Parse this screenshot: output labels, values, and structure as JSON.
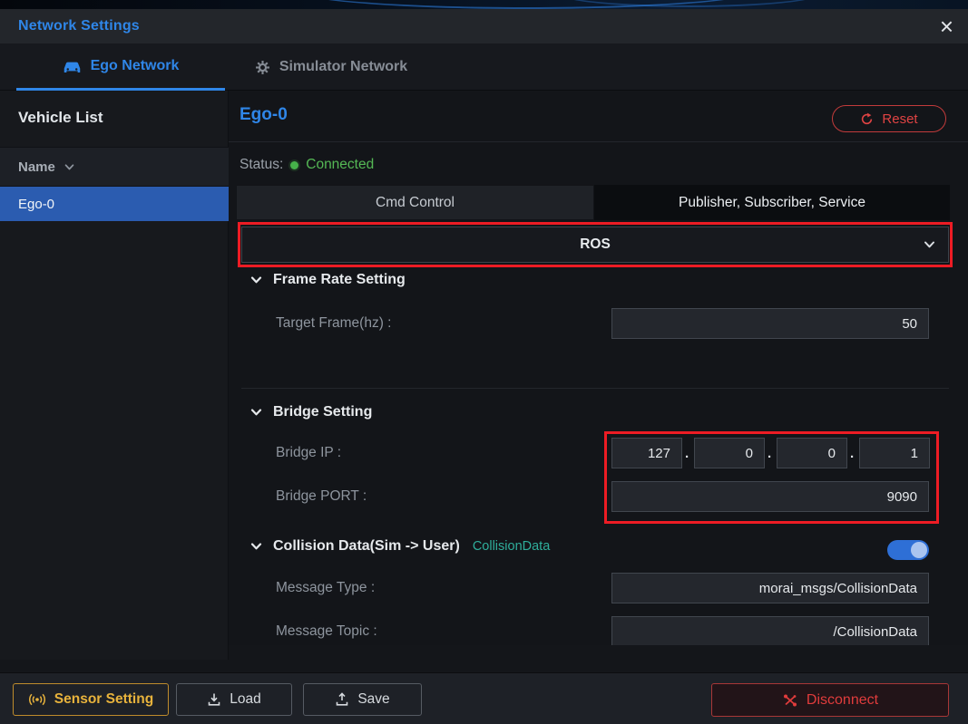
{
  "colors": {
    "accent_blue": "#2f86e8",
    "status_green": "#55b855",
    "tag_teal": "#2fae9b",
    "danger_red": "#e03c3c",
    "warning_yellow": "#e8b33c",
    "annotation_red": "#ed1c24",
    "selected_row_blue": "#2b5cb0",
    "toggle_on_blue": "#2e6fd6"
  },
  "titlebar": {
    "title": "Network Settings",
    "close_glyph": "×"
  },
  "tabs": [
    {
      "label": "Ego Network",
      "active": true
    },
    {
      "label": "Simulator Network",
      "active": false
    }
  ],
  "sidebar": {
    "title": "Vehicle List",
    "column_header": "Name",
    "items": [
      {
        "label": "Ego-0",
        "selected": true
      }
    ]
  },
  "main": {
    "vehicle_title": "Ego-0",
    "reset_label": "Reset",
    "status_label": "Status:",
    "status_value": "Connected",
    "subtabs": [
      {
        "label": "Cmd Control",
        "active": false
      },
      {
        "label": "Publisher, Subscriber, Service",
        "active": true
      }
    ],
    "protocol": {
      "value": "ROS"
    },
    "sections": [
      {
        "title": "Frame Rate Setting",
        "fields": [
          {
            "label": "Target Frame(hz) :",
            "value": "50"
          }
        ]
      },
      {
        "title": "Bridge Setting",
        "fields": [
          {
            "label": "Bridge IP :",
            "ip": [
              "127",
              "0",
              "0",
              "1"
            ],
            "separator": "."
          },
          {
            "label": "Bridge PORT :",
            "value": "9090"
          }
        ]
      },
      {
        "title": "Collision Data(Sim -> User)",
        "tag": "CollisionData",
        "toggle_on": true,
        "fields": [
          {
            "label": "Message Type :",
            "value": "morai_msgs/CollisionData"
          },
          {
            "label": "Message Topic :",
            "value": "/CollisionData"
          }
        ]
      }
    ]
  },
  "footer": {
    "sensor_setting_label": "Sensor Setting",
    "load_label": "Load",
    "save_label": "Save",
    "disconnect_label": "Disconnect"
  }
}
